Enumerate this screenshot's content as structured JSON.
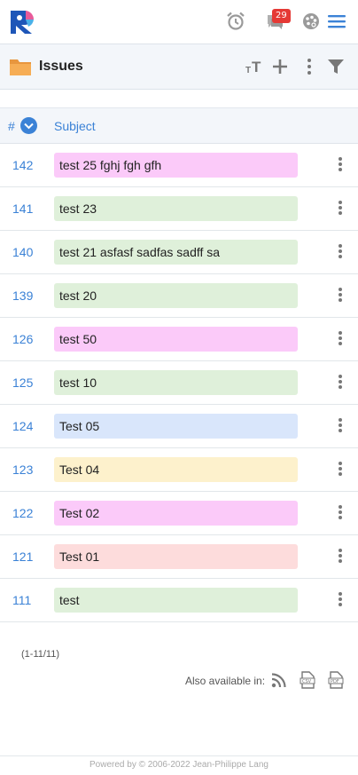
{
  "topbar": {
    "logo": "redmine-logo",
    "icons": [
      "alarm-clock-icon",
      "notifications-icon",
      "palette-icon",
      "hamburger-menu-icon"
    ],
    "notification_count": "29"
  },
  "header": {
    "icon": "folder-icon",
    "title": "Issues",
    "actions": [
      "text-size-icon",
      "add-icon",
      "more-options-icon",
      "filter-icon"
    ]
  },
  "table": {
    "columns": {
      "id": "#",
      "subject": "Subject"
    },
    "rows": [
      {
        "id": "142",
        "subject": "test 25 fghj fgh gfh",
        "color": "#fbcaf9"
      },
      {
        "id": "141",
        "subject": "test 23",
        "color": "#dff0da"
      },
      {
        "id": "140",
        "subject": "test 21 asfasf sadfas sadff sa",
        "color": "#dff0da"
      },
      {
        "id": "139",
        "subject": "test 20",
        "color": "#dff0da"
      },
      {
        "id": "126",
        "subject": "test 50",
        "color": "#fbcaf9"
      },
      {
        "id": "125",
        "subject": "test 10",
        "color": "#dff0da"
      },
      {
        "id": "124",
        "subject": "Test 05",
        "color": "#d9e6fb"
      },
      {
        "id": "123",
        "subject": "Test 04",
        "color": "#fdf1cc"
      },
      {
        "id": "122",
        "subject": "Test 02",
        "color": "#fbcaf9"
      },
      {
        "id": "121",
        "subject": "Test 01",
        "color": "#fddcdc"
      },
      {
        "id": "111",
        "subject": "test",
        "color": "#dff0da"
      }
    ]
  },
  "pagination": "(1-11/11)",
  "export": {
    "label": "Also available in:",
    "formats": [
      "rss-icon",
      "csv-icon",
      "pdf-icon"
    ]
  },
  "footer": "Powered by © 2006-2022 Jean-Philippe Lang",
  "colors": {
    "accent": "#3b82d6",
    "badge": "#e53935"
  }
}
